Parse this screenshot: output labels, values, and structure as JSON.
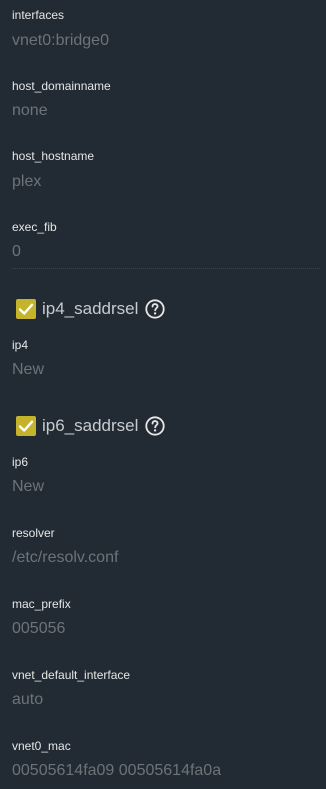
{
  "fields": [
    {
      "label": "interfaces",
      "value": "vnet0:bridge0"
    },
    {
      "label": "host_domainname",
      "value": "none"
    },
    {
      "label": "host_hostname",
      "value": "plex"
    },
    {
      "label": "exec_fib",
      "value": "0"
    },
    {
      "label": "ip4",
      "value": "New"
    },
    {
      "label": "ip6",
      "value": "New"
    },
    {
      "label": "resolver",
      "value": "/etc/resolv.conf"
    },
    {
      "label": "mac_prefix",
      "value": "005056"
    },
    {
      "label": "vnet_default_interface",
      "value": "auto"
    },
    {
      "label": "vnet0_mac",
      "value": "00505614fa09 00505614fa0a"
    }
  ],
  "checkboxes": [
    {
      "label": "ip4_saddrsel",
      "checked": true,
      "help_icon": "question-circle-icon"
    },
    {
      "label": "ip6_saddrsel",
      "checked": true,
      "help_icon": "question-circle-icon"
    }
  ],
  "colors": {
    "background": "#222b33",
    "checkbox_fill": "#c5b32b",
    "label_text": "#e6e6e6",
    "value_text": "#6d7378"
  }
}
